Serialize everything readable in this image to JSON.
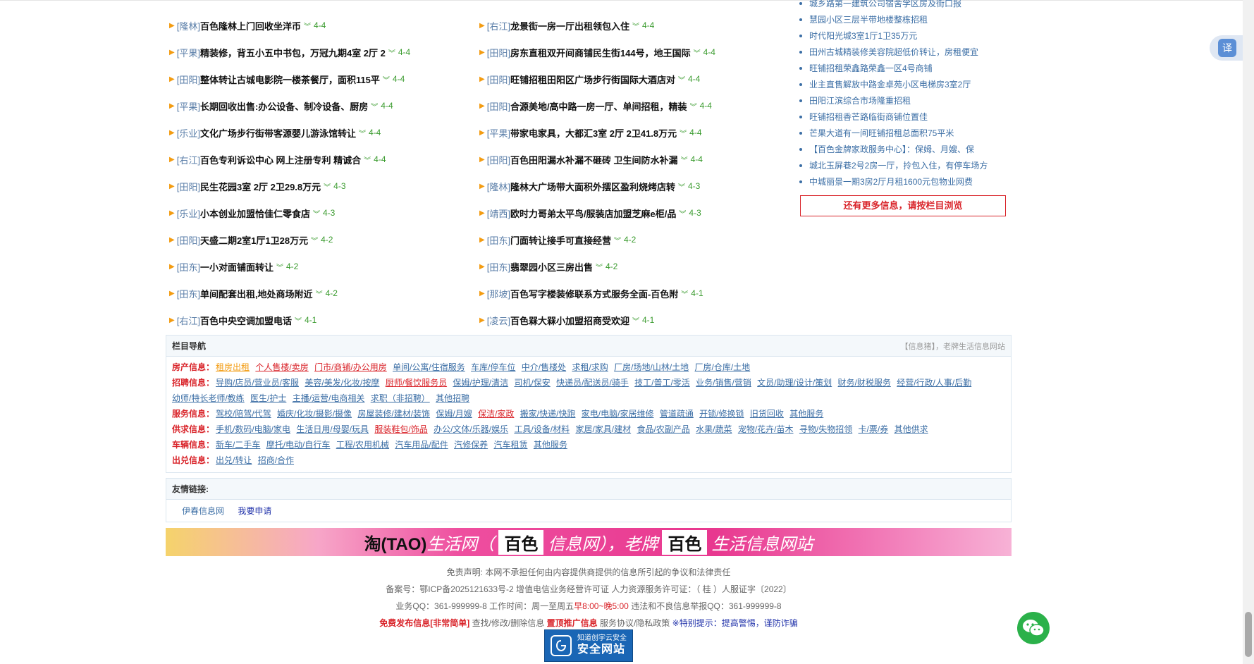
{
  "listings": [
    [
      {
        "area": "[隆林]",
        "title": "百色隆林上门回收坐洋币",
        "date": "4-4"
      },
      {
        "area": "[右江]",
        "title": "龙景街一房一厅出租领包入住",
        "date": "4-4"
      }
    ],
    [
      {
        "area": "[平果]",
        "title": "精装修，背五小五中书包，万冠九期4室 2厅 2",
        "date": "4-4"
      },
      {
        "area": "[田阳]",
        "title": "房东直租双开间商铺民生街144号，地王国际",
        "date": "4-4"
      }
    ],
    [
      {
        "area": "[田阳]",
        "title": "整体转让古城电影院一楼茶餐厅，面积115平",
        "date": "4-4"
      },
      {
        "area": "[田阳]",
        "title": "旺铺招租田阳区广场步行街国际大酒店对",
        "date": "4-4"
      }
    ],
    [
      {
        "area": "[平果]",
        "title": "长期回收出售:办公设备、制冷设备、厨房",
        "date": "4-4"
      },
      {
        "area": "[田阳]",
        "title": "合源美地/高中路一房一厅、单间招租，精装",
        "date": "4-4"
      }
    ],
    [
      {
        "area": "[乐业]",
        "title": "文化广场步行街带客源婴儿游泳馆转让",
        "date": "4-4"
      },
      {
        "area": "[平果]",
        "title": "带家电家具，大都汇3室 2厅 2卫41.8万元",
        "date": "4-4"
      }
    ],
    [
      {
        "area": "[右江]",
        "title": "百色专利诉讼中心 网上注册专利 精诚合",
        "date": "4-4"
      },
      {
        "area": "[田阳]",
        "title": "百色田阳漏水补漏不砸砖 卫生间防水补漏",
        "date": "4-4"
      }
    ],
    [
      {
        "area": "[田阳]",
        "title": "民生花园3室 2厅 2卫29.8万元",
        "date": "4-3"
      },
      {
        "area": "[隆林]",
        "title": "隆林大广场带大面积外摆区盈利烧烤店转",
        "date": "4-3"
      }
    ],
    [
      {
        "area": "[乐业]",
        "title": "小本创业加盟恰佳仁零食店",
        "date": "4-3"
      },
      {
        "area": "[靖西]",
        "title": "欧时力哥弟太平鸟/服装店加盟芝麻e柜/品",
        "date": "4-3"
      }
    ],
    [
      {
        "area": "[田阳]",
        "title": "天盛二期2室1厅1卫28万元",
        "date": "4-2"
      },
      {
        "area": "[田东]",
        "title": "门面转让接手可直接经营",
        "date": "4-2"
      }
    ],
    [
      {
        "area": "[田东]",
        "title": "一小对面铺面转让",
        "date": "4-2"
      },
      {
        "area": "[田东]",
        "title": "翡翠园小区三房出售",
        "date": "4-2"
      }
    ],
    [
      {
        "area": "[田东]",
        "title": "单间配套出租,地处商场附近",
        "date": "4-2"
      },
      {
        "area": "[那坡]",
        "title": "百色写字楼装修联系方式服务全面-百色附",
        "date": "4-1"
      }
    ],
    [
      {
        "area": "[右江]",
        "title": "百色中央空调加盟电话",
        "date": "4-1"
      },
      {
        "area": "[凌云]",
        "title": "百色槑大槑小加盟招商受欢迎",
        "date": "4-1"
      }
    ]
  ],
  "sidebar": {
    "items": [
      "城乡路第一建筑公司宿舍学区房及街口报",
      "慧园小区三层半带地楼整栋招租",
      "时代阳光城3室1厅1卫35万元",
      "田州古城精装修美容院超低价转让，房租便宜",
      "旺铺招租荣鑫路荣鑫一区4号商铺",
      "业主直售解放中路金卓苑小区电梯房3室2厅",
      "田阳江滨综合市场隆重招租",
      "旺铺招租香芒路临街商铺位置佳",
      "芒果大道有一间旺铺招租总面积75平米",
      "【百色金牌家政服务中心】：保姆、月嫂、保",
      "城北玉屏巷2号2房一厅，拎包入住，有停车场方",
      "中城丽景一期3房2厅月租1600元包物业网费"
    ],
    "more_label": "还有更多信息，请按栏目浏览"
  },
  "catnav": {
    "title": "栏目导航",
    "slogan": "【信息猪】，老牌生活信息网站",
    "rows": [
      {
        "label": "房产信息：",
        "links": [
          {
            "text": "租房出租",
            "style": "orange"
          },
          {
            "text": "个人售楼/卖房",
            "style": "red"
          },
          {
            "text": "门市/商铺/办公用房",
            "style": "red"
          },
          {
            "text": "单间/公寓/住宿服务",
            "style": ""
          },
          {
            "text": "车库/停车位",
            "style": ""
          },
          {
            "text": "中介/售楼处",
            "style": ""
          },
          {
            "text": "求租/求购",
            "style": ""
          },
          {
            "text": "厂房/场地/山林/土地",
            "style": ""
          },
          {
            "text": "厂房/仓库/土地",
            "style": ""
          }
        ]
      },
      {
        "label": "招聘信息：",
        "links": [
          {
            "text": "导购/店员/营业员/客服",
            "style": ""
          },
          {
            "text": "美容/美发/化妆/按摩",
            "style": ""
          },
          {
            "text": "厨师/餐饮服务员",
            "style": "red"
          },
          {
            "text": "保姆/护理/清洁",
            "style": ""
          },
          {
            "text": "司机/保安",
            "style": ""
          },
          {
            "text": "快递员/配送员/骑手",
            "style": ""
          },
          {
            "text": "技工/普工/零活",
            "style": ""
          },
          {
            "text": "业务/销售/营销",
            "style": ""
          },
          {
            "text": "文员/助理/设计/策划",
            "style": ""
          },
          {
            "text": "财务/财税服务",
            "style": ""
          },
          {
            "text": "经营/行政/人事/后勤",
            "style": ""
          },
          {
            "text": "幼师/特长老师/教练",
            "style": ""
          },
          {
            "text": "医生/护士",
            "style": ""
          },
          {
            "text": "主播/运营/电商相关",
            "style": ""
          },
          {
            "text": "求职（非招聘）",
            "style": ""
          },
          {
            "text": "其他招聘",
            "style": ""
          }
        ]
      },
      {
        "label": "服务信息：",
        "links": [
          {
            "text": "驾校/陪驾/代驾",
            "style": ""
          },
          {
            "text": "婚庆/化妆/摄影/摄像",
            "style": ""
          },
          {
            "text": "房屋装修/建材/装饰",
            "style": ""
          },
          {
            "text": "保姆/月嫂",
            "style": ""
          },
          {
            "text": "保洁/家政",
            "style": "red"
          },
          {
            "text": "搬家/快递/快跑",
            "style": ""
          },
          {
            "text": "家电/电脑/家居维修",
            "style": ""
          },
          {
            "text": "管道疏通",
            "style": ""
          },
          {
            "text": "开锁/修换锁",
            "style": ""
          },
          {
            "text": "旧货回收",
            "style": ""
          },
          {
            "text": "其他服务",
            "style": ""
          }
        ]
      },
      {
        "label": "供求信息：",
        "links": [
          {
            "text": "手机/数码/电脑/家电",
            "style": ""
          },
          {
            "text": "生活日用/母婴/玩具",
            "style": ""
          },
          {
            "text": "服装鞋包/饰品",
            "style": "red"
          },
          {
            "text": "办公/文体/乐器/娱乐",
            "style": ""
          },
          {
            "text": "工具/设备/材料",
            "style": ""
          },
          {
            "text": "家居/家具/建材",
            "style": ""
          },
          {
            "text": "食品/农副产品",
            "style": ""
          },
          {
            "text": "水果/蔬菜",
            "style": ""
          },
          {
            "text": "宠物/花卉/苗木",
            "style": ""
          },
          {
            "text": "寻物/失物招领",
            "style": ""
          },
          {
            "text": "卡/票/券",
            "style": ""
          },
          {
            "text": "其他供求",
            "style": ""
          }
        ]
      },
      {
        "label": "车辆信息：",
        "links": [
          {
            "text": "新车/二手车",
            "style": ""
          },
          {
            "text": "摩托/电动/自行车",
            "style": ""
          },
          {
            "text": "工程/农用机械",
            "style": ""
          },
          {
            "text": "汽车用品/配件",
            "style": ""
          },
          {
            "text": "汽修保养",
            "style": ""
          },
          {
            "text": "汽车租赁",
            "style": ""
          },
          {
            "text": "其他服务",
            "style": ""
          }
        ]
      },
      {
        "label": "出兑信息：",
        "links": [
          {
            "text": "出兑/转让",
            "style": ""
          },
          {
            "text": "招商/合作",
            "style": ""
          }
        ]
      }
    ]
  },
  "friends": {
    "title": "友情链接:",
    "links": [
      "伊春信息网",
      "我要申请"
    ]
  },
  "banner": {
    "part1": "淘(TAO)",
    "part2": "生活网（",
    "part3": "百色",
    "part4": "信息网），老牌",
    "part5": "百色",
    "part6": "生活信息网站"
  },
  "footer": {
    "disclaimer": "免责声明: 本网不承担任何由内容提供商提供的信息所引起的争议和法律责任",
    "icp": "备案号：鄂ICP备2025121633号-2    增值电信业务经营许可证    人力资源服务许可证：（ 桂 ）人服证字〔2022〕",
    "qq_label": "业务QQ：361-999999-8 工作时间：周一至周五",
    "hours": "早8:00~晚5:00",
    "report": "违法和不良信息举报QQ：361-999999-8",
    "free_post": "免费发布信息[非常简单]",
    "manage": "查找/修改/删除信息",
    "promote": "置顶推广信息",
    "agreement": "服务协议/隐私政策",
    "warning_label": "※特别提示：",
    "warning": "提高警惕，谨防诈骗",
    "badge_line1": "知道创宇云安全",
    "badge_line2": "安全网站"
  },
  "widgets": {
    "translate_label": "译"
  }
}
